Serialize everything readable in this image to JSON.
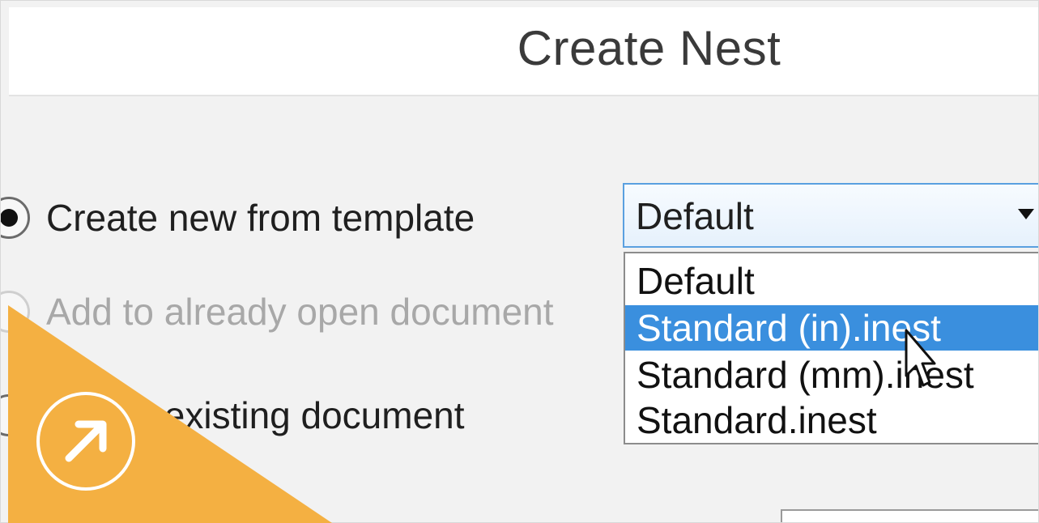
{
  "dialog": {
    "title": "Create Nest"
  },
  "options": {
    "create_new": "Create new from template",
    "add_open": "Add to already open document",
    "add_existing": "Add to existing document"
  },
  "template_combo": {
    "value": "Default",
    "items": [
      "Default",
      "Standard (in).inest",
      "Standard (mm).inest",
      "Standard.inest"
    ],
    "highlighted": "Standard (in).inest"
  },
  "colors": {
    "accent_blue": "#3a8fde",
    "badge_orange": "#f4b042"
  },
  "icons": {
    "cursor": "mouse-pointer-icon",
    "badge": "external-link-arrow-icon"
  }
}
